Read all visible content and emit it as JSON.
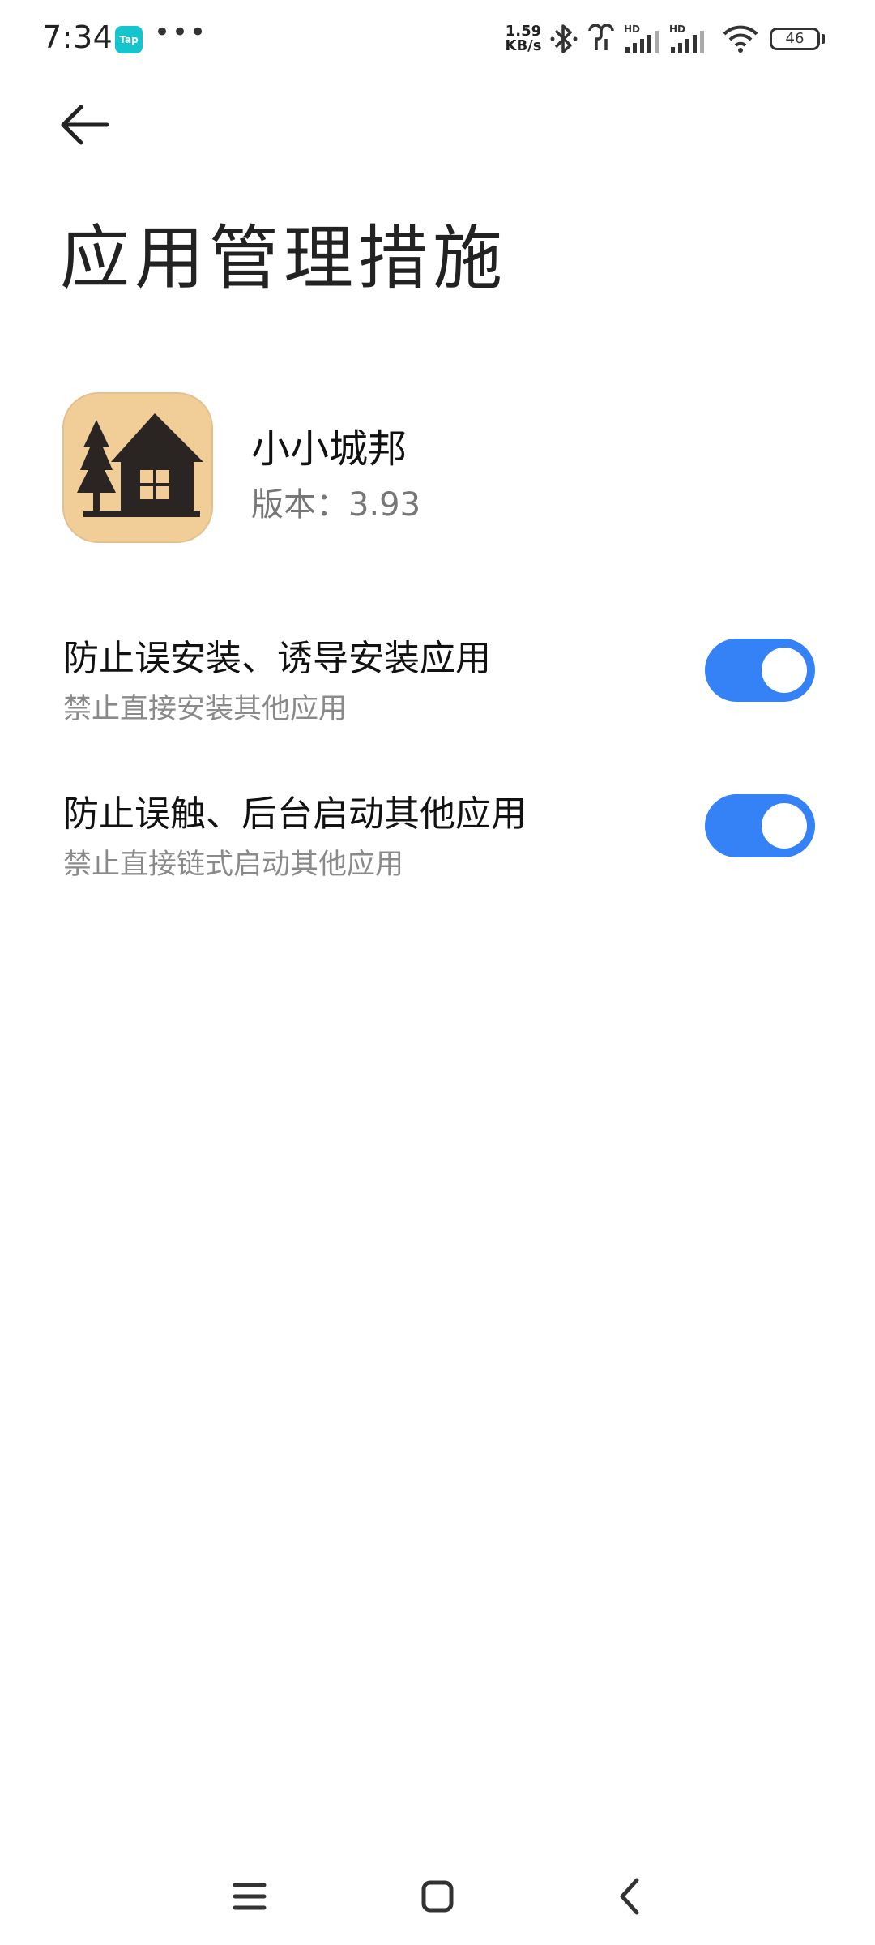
{
  "status_bar": {
    "time": "7:34",
    "tap_badge": "Tap",
    "more_dots": "•••",
    "net_speed_value": "1.59",
    "net_speed_unit": "KB/s",
    "signal_label_1": "HD",
    "signal_label_2": "HD",
    "battery": "46"
  },
  "header": {
    "title": "应用管理措施"
  },
  "app": {
    "name": "小小城邦",
    "version": "版本：3.93",
    "icon": "house-tree-icon"
  },
  "settings": [
    {
      "title": "防止误安装、诱导安装应用",
      "subtitle": "禁止直接安装其他应用",
      "enabled": true
    },
    {
      "title": "防止误触、后台启动其他应用",
      "subtitle": "禁止直接链式启动其他应用",
      "enabled": true
    }
  ],
  "colors": {
    "accent": "#3482f6",
    "app_icon_bg": "#f1cd98"
  }
}
